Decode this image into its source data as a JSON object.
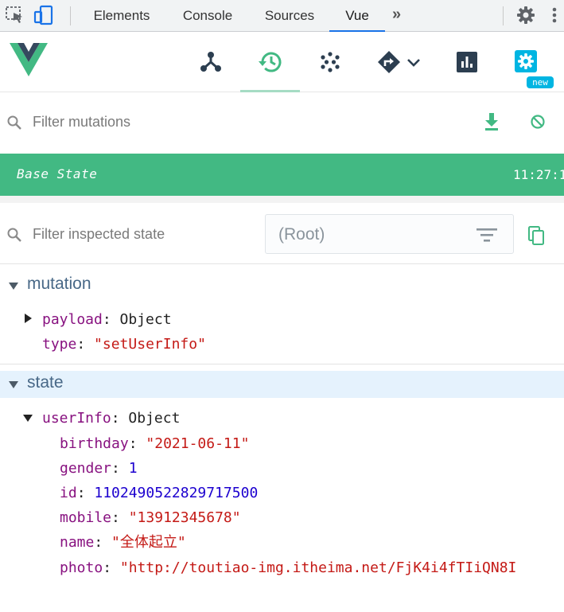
{
  "devtools": {
    "tabs": [
      "Elements",
      "Console",
      "Sources",
      "Vue"
    ],
    "active_tab": "Vue",
    "more_label": "»"
  },
  "vue_header": {
    "nav": [
      "components-icon",
      "timeline-icon",
      "vuex-icon",
      "router-icon",
      "performance-icon",
      "settings-icon"
    ],
    "active_nav": "timeline-icon",
    "badge": "new",
    "accent": "#42b983"
  },
  "mutations": {
    "filter_placeholder": "Filter mutations",
    "base_state_label": "Base State",
    "base_state_time": "11:27:1"
  },
  "inspector": {
    "filter_placeholder": "Filter inspected state",
    "root_value": "(Root)"
  },
  "tree": {
    "mutation_section": "mutation",
    "payload_key": "payload",
    "payload_value": "Object",
    "type_key": "type",
    "type_value": "\"setUserInfo\"",
    "state_section": "state",
    "userinfo_key": "userInfo",
    "userinfo_value": "Object",
    "birthday_key": "birthday",
    "birthday_value": "\"2021-06-11\"",
    "gender_key": "gender",
    "gender_value": "1",
    "id_key": "id",
    "id_value": "1102490522829717500",
    "mobile_key": "mobile",
    "mobile_value": "\"13912345678\"",
    "name_key": "name",
    "name_value": "\"全体起立\"",
    "photo_key": "photo",
    "photo_value": "\"http://toutiao-img.itheima.net/FjK4i4fTIiQN8I"
  }
}
